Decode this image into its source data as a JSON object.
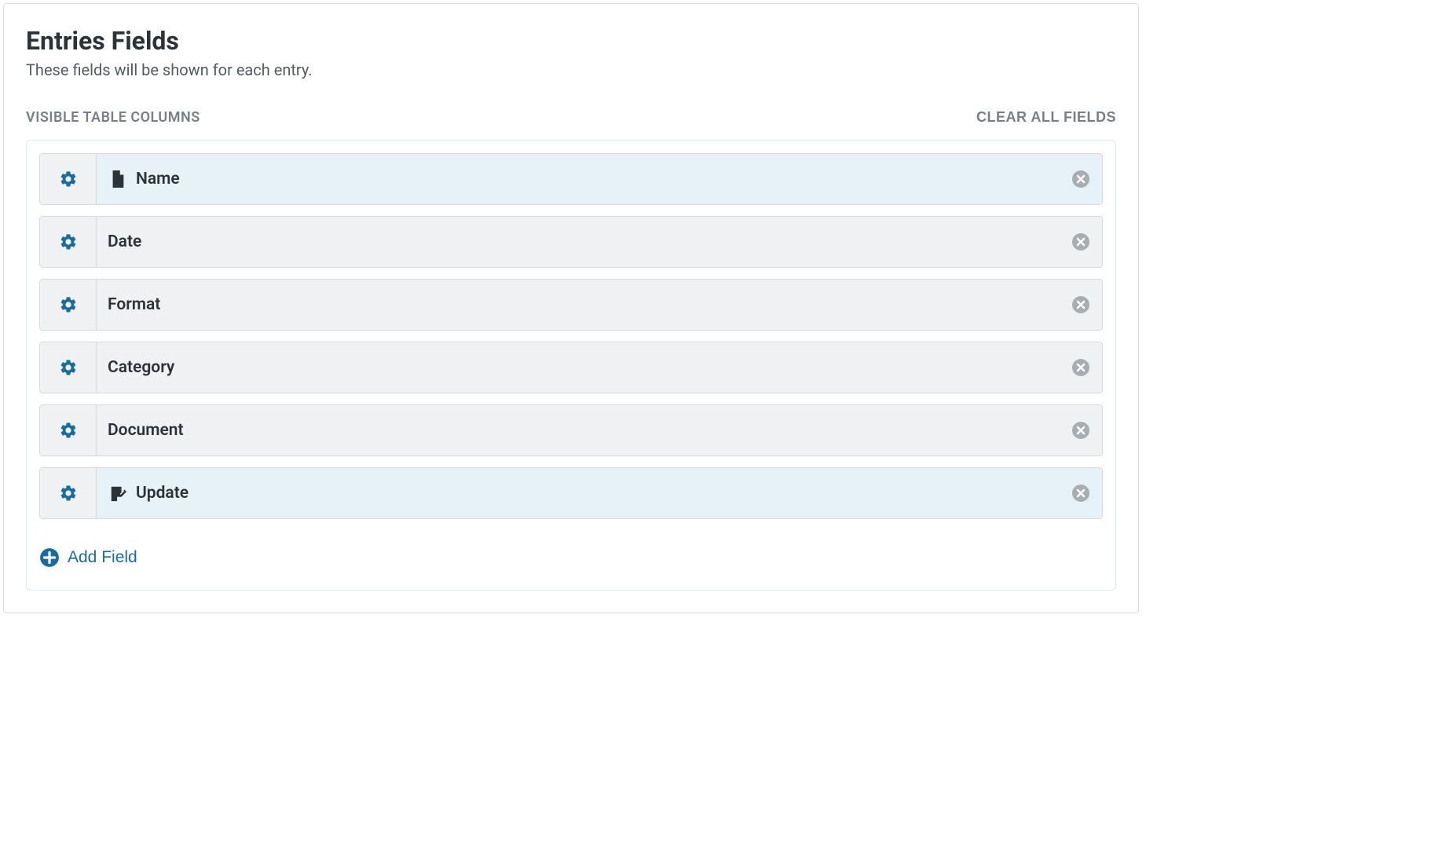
{
  "header": {
    "title": "Entries Fields",
    "subtitle": "These fields will be shown for each entry."
  },
  "section": {
    "label": "VISIBLE TABLE COLUMNS",
    "clear_all": "CLEAR ALL FIELDS"
  },
  "fields": [
    {
      "label": "Name",
      "icon": "document-icon",
      "selected": true
    },
    {
      "label": "Date",
      "icon": null,
      "selected": false
    },
    {
      "label": "Format",
      "icon": null,
      "selected": false
    },
    {
      "label": "Category",
      "icon": null,
      "selected": false
    },
    {
      "label": "Document",
      "icon": null,
      "selected": false
    },
    {
      "label": "Update",
      "icon": "edit-icon",
      "selected": true
    }
  ],
  "add_field": {
    "label": "Add Field"
  },
  "colors": {
    "gear": "#1a6b9e",
    "close": "#a8adb3",
    "text": "#2c3338"
  }
}
